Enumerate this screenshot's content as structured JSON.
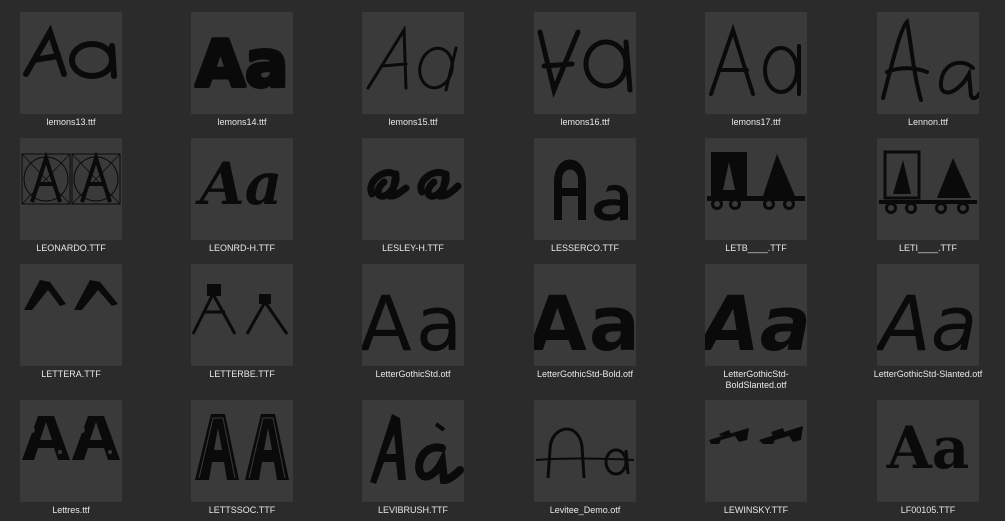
{
  "files": [
    {
      "name": "lemons13.ttf",
      "icon": "font-preview-icon"
    },
    {
      "name": "lemons14.ttf",
      "icon": "font-preview-icon"
    },
    {
      "name": "lemons15.ttf",
      "icon": "font-preview-icon"
    },
    {
      "name": "lemons16.ttf",
      "icon": "font-preview-icon"
    },
    {
      "name": "lemons17.ttf",
      "icon": "font-preview-icon"
    },
    {
      "name": "Lennon.ttf",
      "icon": "font-preview-icon"
    },
    {
      "name": "LEONARDO.TTF",
      "icon": "font-preview-icon"
    },
    {
      "name": "LEONRD-H.TTF",
      "icon": "font-preview-icon"
    },
    {
      "name": "LESLEY-H.TTF",
      "icon": "font-preview-icon"
    },
    {
      "name": "LESSERCO.TTF",
      "icon": "font-preview-icon"
    },
    {
      "name": "LETB____.TTF",
      "icon": "font-preview-icon"
    },
    {
      "name": "LETI____.TTF",
      "icon": "font-preview-icon"
    },
    {
      "name": "LETTERA.TTF",
      "icon": "font-preview-icon"
    },
    {
      "name": "LETTERBE.TTF",
      "icon": "font-preview-icon"
    },
    {
      "name": "LetterGothicStd.otf",
      "icon": "font-preview-icon"
    },
    {
      "name": "LetterGothicStd-Bold.otf",
      "icon": "font-preview-icon"
    },
    {
      "name": "LetterGothicStd-BoldSlanted.otf",
      "display": "LetterGothicStd-\nBoldSlanted.otf",
      "icon": "font-preview-icon"
    },
    {
      "name": "LetterGothicStd-Slanted.otf",
      "icon": "font-preview-icon"
    },
    {
      "name": "Lettres.ttf",
      "icon": "font-preview-icon"
    },
    {
      "name": "LETTSSOC.TTF",
      "icon": "font-preview-icon"
    },
    {
      "name": "LEVIBRUSH.TTF",
      "icon": "font-preview-icon"
    },
    {
      "name": "Levitee_Demo.otf",
      "icon": "font-preview-icon"
    },
    {
      "name": "LEWINSKY.TTF",
      "icon": "font-preview-icon"
    },
    {
      "name": "LF00105.TTF",
      "icon": "font-preview-icon"
    }
  ],
  "preview_text": "Aa",
  "colors": {
    "background": "#2b2b2b",
    "thumb": "#3a3a3a",
    "label": "#e8e8e8",
    "glyph": "#0a0a0a"
  }
}
